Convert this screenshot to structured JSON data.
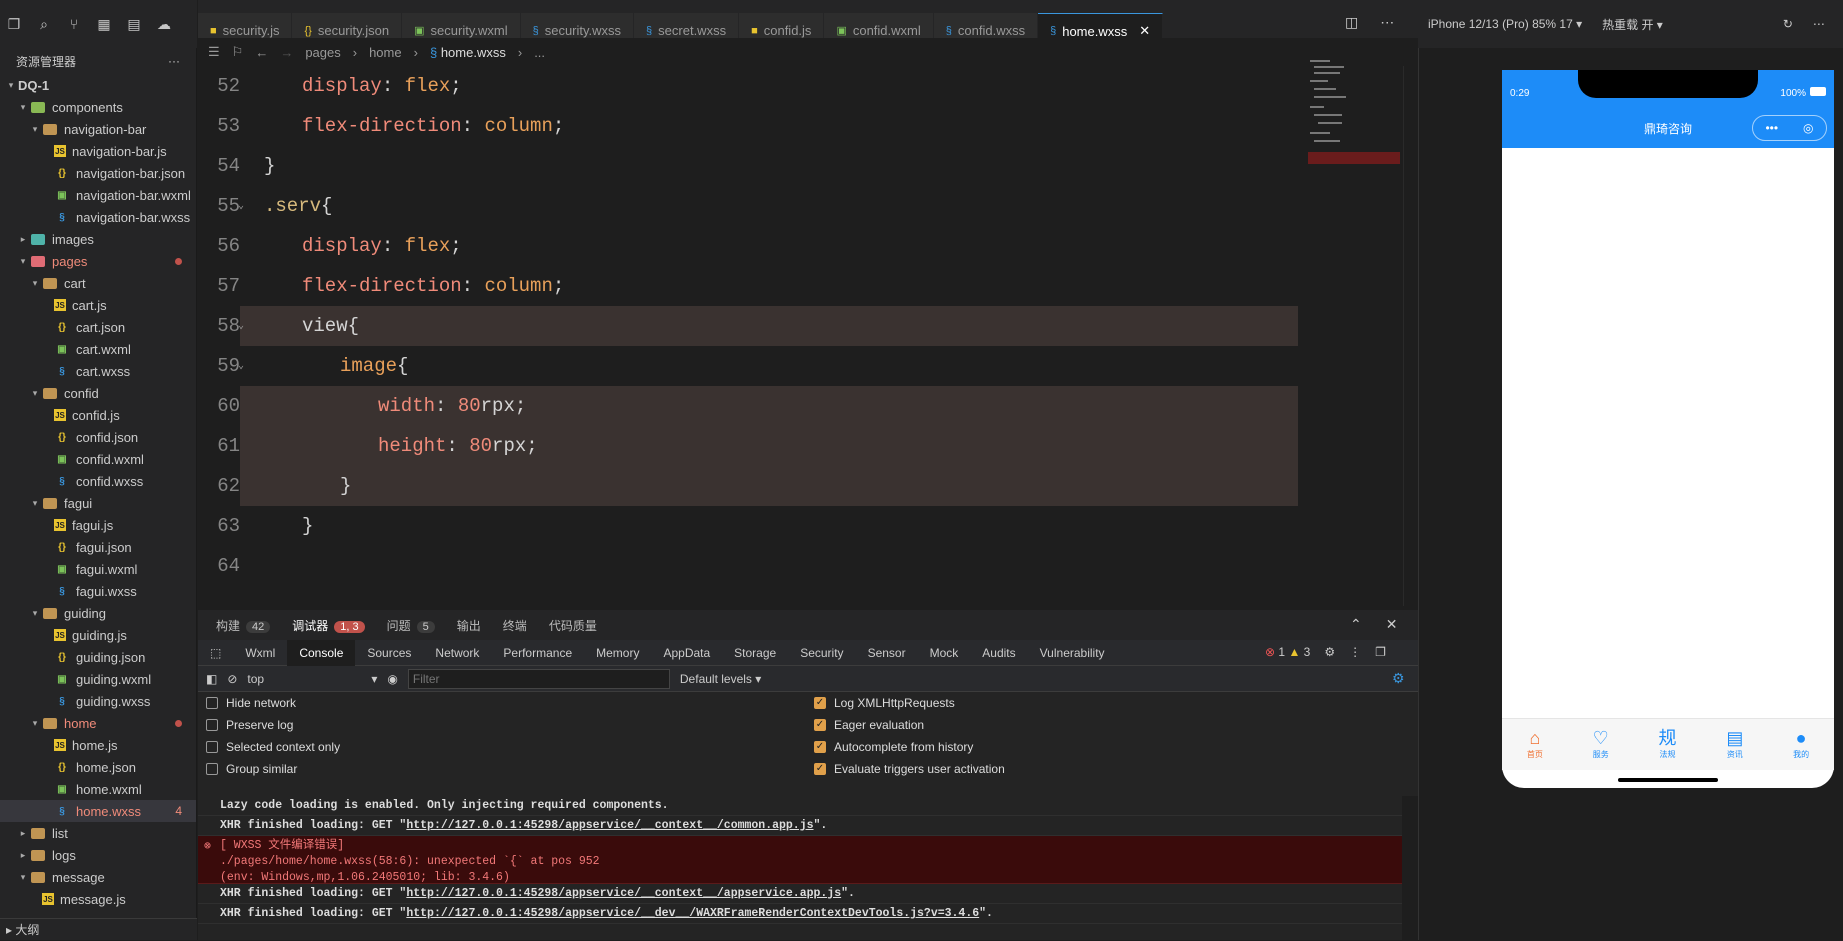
{
  "explorer": {
    "title": "资源管理器",
    "more": "···",
    "outline_label": "大纲",
    "tree": [
      {
        "label": "DQ-1",
        "kind": "root",
        "indent": 0,
        "open": true
      },
      {
        "label": "components",
        "kind": "folder-comp",
        "indent": 1,
        "open": true
      },
      {
        "label": "navigation-bar",
        "kind": "folder",
        "indent": 2,
        "open": true
      },
      {
        "label": "navigation-bar.js",
        "kind": "js",
        "indent": 3
      },
      {
        "label": "navigation-bar.json",
        "kind": "json",
        "indent": 3
      },
      {
        "label": "navigation-bar.wxml",
        "kind": "wxml",
        "indent": 3
      },
      {
        "label": "navigation-bar.wxss",
        "kind": "wxss",
        "indent": 3
      },
      {
        "label": "images",
        "kind": "folder-img",
        "indent": 1,
        "open": false
      },
      {
        "label": "pages",
        "kind": "folder-pg",
        "indent": 1,
        "open": true,
        "error": true
      },
      {
        "label": "cart",
        "kind": "folder",
        "indent": 2,
        "open": true
      },
      {
        "label": "cart.js",
        "kind": "js",
        "indent": 3
      },
      {
        "label": "cart.json",
        "kind": "json",
        "indent": 3
      },
      {
        "label": "cart.wxml",
        "kind": "wxml",
        "indent": 3
      },
      {
        "label": "cart.wxss",
        "kind": "wxss",
        "indent": 3
      },
      {
        "label": "confid",
        "kind": "folder",
        "indent": 2,
        "open": true
      },
      {
        "label": "confid.js",
        "kind": "js",
        "indent": 3
      },
      {
        "label": "confid.json",
        "kind": "json",
        "indent": 3
      },
      {
        "label": "confid.wxml",
        "kind": "wxml",
        "indent": 3
      },
      {
        "label": "confid.wxss",
        "kind": "wxss",
        "indent": 3
      },
      {
        "label": "fagui",
        "kind": "folder",
        "indent": 2,
        "open": true
      },
      {
        "label": "fagui.js",
        "kind": "js",
        "indent": 3
      },
      {
        "label": "fagui.json",
        "kind": "json",
        "indent": 3
      },
      {
        "label": "fagui.wxml",
        "kind": "wxml",
        "indent": 3
      },
      {
        "label": "fagui.wxss",
        "kind": "wxss",
        "indent": 3
      },
      {
        "label": "guiding",
        "kind": "folder",
        "indent": 2,
        "open": true
      },
      {
        "label": "guiding.js",
        "kind": "js",
        "indent": 3
      },
      {
        "label": "guiding.json",
        "kind": "json",
        "indent": 3
      },
      {
        "label": "guiding.wxml",
        "kind": "wxml",
        "indent": 3
      },
      {
        "label": "guiding.wxss",
        "kind": "wxss",
        "indent": 3
      },
      {
        "label": "home",
        "kind": "folder",
        "indent": 2,
        "open": true,
        "error": true
      },
      {
        "label": "home.js",
        "kind": "js",
        "indent": 3
      },
      {
        "label": "home.json",
        "kind": "json",
        "indent": 3
      },
      {
        "label": "home.wxml",
        "kind": "wxml",
        "indent": 3
      },
      {
        "label": "home.wxss",
        "kind": "wxss",
        "indent": 3,
        "selected": true,
        "badge": "4"
      },
      {
        "label": "list",
        "kind": "folder",
        "indent": 1,
        "open": false
      },
      {
        "label": "logs",
        "kind": "folder",
        "indent": 1,
        "open": false
      },
      {
        "label": "message",
        "kind": "folder",
        "indent": 1,
        "open": true
      },
      {
        "label": "message.js",
        "kind": "js",
        "indent": 2
      }
    ]
  },
  "tabs": [
    {
      "label": "security.js",
      "icon": "js"
    },
    {
      "label": "security.json",
      "icon": "json"
    },
    {
      "label": "security.wxml",
      "icon": "wxml"
    },
    {
      "label": "security.wxss",
      "icon": "wxss"
    },
    {
      "label": "secret.wxss",
      "icon": "wxss"
    },
    {
      "label": "confid.js",
      "icon": "js"
    },
    {
      "label": "confid.wxml",
      "icon": "wxml"
    },
    {
      "label": "confid.wxss",
      "icon": "wxss"
    },
    {
      "label": "home.wxss",
      "icon": "wxss",
      "active": true,
      "close": "✕"
    }
  ],
  "breadcrumb": {
    "p1": "pages",
    "p2": "home",
    "p3": "home.wxss",
    "p4": "..."
  },
  "code": [
    {
      "n": "52",
      "indent": 1,
      "parts": [
        [
          "prop",
          "display"
        ],
        [
          "brace",
          ": "
        ],
        [
          "val",
          "flex"
        ],
        [
          "brace",
          ";"
        ]
      ]
    },
    {
      "n": "53",
      "indent": 1,
      "parts": [
        [
          "prop",
          "flex-direction"
        ],
        [
          "brace",
          ": "
        ],
        [
          "val",
          "column"
        ],
        [
          "brace",
          ";"
        ]
      ]
    },
    {
      "n": "54",
      "indent": 0,
      "parts": [
        [
          "brace",
          "}"
        ]
      ]
    },
    {
      "n": "55",
      "indent": 0,
      "fold": true,
      "parts": [
        [
          "sel2",
          ".serv"
        ],
        [
          "brace",
          "{"
        ]
      ]
    },
    {
      "n": "56",
      "indent": 1,
      "parts": [
        [
          "prop",
          "display"
        ],
        [
          "brace",
          ": "
        ],
        [
          "val",
          "flex"
        ],
        [
          "brace",
          ";"
        ]
      ]
    },
    {
      "n": "57",
      "indent": 1,
      "parts": [
        [
          "prop",
          "flex-direction"
        ],
        [
          "brace",
          ": "
        ],
        [
          "val",
          "column"
        ],
        [
          "brace",
          ";"
        ]
      ]
    },
    {
      "n": "58",
      "indent": 1,
      "fold": true,
      "hl": true,
      "parts": [
        [
          "brace",
          "view{"
        ]
      ]
    },
    {
      "n": "59",
      "indent": 2,
      "fold": true,
      "parts": [
        [
          "val",
          "image"
        ],
        [
          "brace",
          "{"
        ]
      ]
    },
    {
      "n": "60",
      "indent": 3,
      "hl": true,
      "parts": [
        [
          "prop",
          "width"
        ],
        [
          "brace",
          ": "
        ],
        [
          "num",
          "80"
        ],
        [
          "brace",
          "rpx;"
        ]
      ]
    },
    {
      "n": "61",
      "indent": 3,
      "hl": true,
      "parts": [
        [
          "prop",
          "height"
        ],
        [
          "brace",
          ": "
        ],
        [
          "num",
          "80"
        ],
        [
          "brace",
          "rpx;"
        ]
      ]
    },
    {
      "n": "62",
      "indent": 2,
      "hl": true,
      "parts": [
        [
          "brace",
          "}"
        ]
      ]
    },
    {
      "n": "63",
      "indent": 1,
      "parts": [
        [
          "brace",
          "}"
        ]
      ]
    },
    {
      "n": "64",
      "indent": 0,
      "parts": []
    }
  ],
  "panel": {
    "tabs": [
      {
        "label": "构建",
        "count": "42"
      },
      {
        "label": "调试器",
        "count": "1, 3",
        "err": true,
        "active": true
      },
      {
        "label": "问题",
        "count": "5"
      },
      {
        "label": "输出"
      },
      {
        "label": "终端"
      },
      {
        "label": "代码质量"
      }
    ],
    "devtools": [
      "Wxml",
      "Console",
      "Sources",
      "Network",
      "Performance",
      "Memory",
      "AppData",
      "Storage",
      "Security",
      "Sensor",
      "Mock",
      "Audits",
      "Vulnerability"
    ],
    "active_devtool": "Console",
    "errors": "1",
    "warnings": "3",
    "context": "top",
    "filter_placeholder": "Filter",
    "levels": "Default levels",
    "options_left": [
      {
        "label": "Hide network",
        "checked": false
      },
      {
        "label": "Preserve log",
        "checked": false
      },
      {
        "label": "Selected context only",
        "checked": false
      },
      {
        "label": "Group similar",
        "checked": false
      }
    ],
    "options_right": [
      {
        "label": "Log XMLHttpRequests",
        "checked": true
      },
      {
        "label": "Eager evaluation",
        "checked": true
      },
      {
        "label": "Autocomplete from history",
        "checked": true
      },
      {
        "label": "Evaluate triggers user activation",
        "checked": true
      }
    ],
    "logs": [
      {
        "text": "Lazy code loading is enabled. Only injecting required components."
      },
      {
        "text": "XHR finished loading: GET \"",
        "link": "http://127.0.0.1:45298/appservice/__context__/common.app.js",
        "tail": "\"."
      },
      {
        "err": true,
        "l1": "[ WXSS 文件编译错误]",
        "l2": "./pages/home/home.wxss(58:6): unexpected `{` at pos 952",
        "l3": "(env: Windows,mp,1.06.2405010; lib: 3.4.6)"
      },
      {
        "text": "XHR finished loading: GET \"",
        "link": "http://127.0.0.1:45298/appservice/__context__/appservice.app.js",
        "tail": "\"."
      },
      {
        "text": "XHR finished loading: GET \"",
        "link": "http://127.0.0.1:45298/appservice/__dev__/WAXRFrameRenderContextDevTools.js?v=3.4.6",
        "tail": "\"."
      }
    ]
  },
  "simulator": {
    "device": "iPhone 12/13 (Pro) 85% 17 ▾",
    "hot_reload": "热重载 开 ▾",
    "time": "0:29",
    "battery": "100%",
    "nav_title": "鼎琦咨询",
    "tabbar": [
      {
        "label": "首页",
        "icon": "⌂",
        "active": true
      },
      {
        "label": "服务",
        "icon": "♡"
      },
      {
        "label": "法规",
        "icon": "规"
      },
      {
        "label": "资讯",
        "icon": "▤"
      },
      {
        "label": "我的",
        "icon": "●"
      }
    ]
  },
  "colors": {
    "accent": "#1d8cf8",
    "error": "#c1524b",
    "tab_active": "#f07030"
  }
}
